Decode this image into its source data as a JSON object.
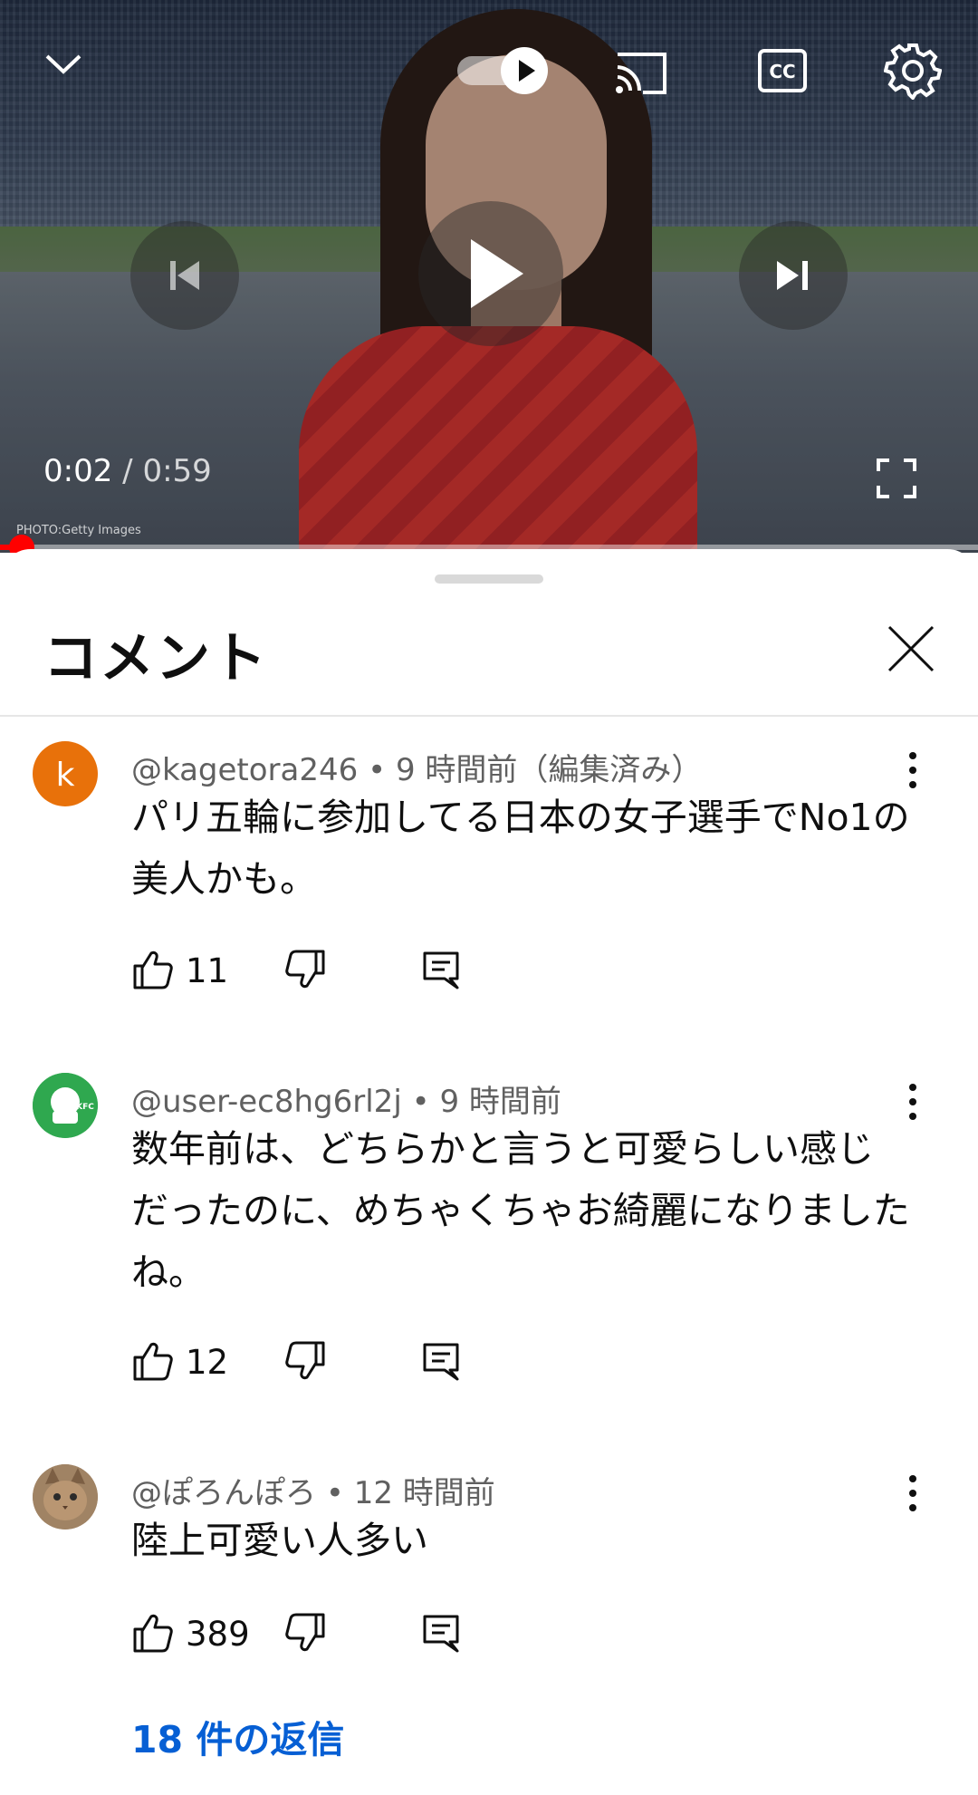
{
  "player": {
    "current_time": "0:02",
    "separator": " / ",
    "duration": "0:59",
    "progress": 0.034,
    "watermark": "PHOTO:Getty Images",
    "autoplay": true,
    "captions": "CC"
  },
  "comments_panel": {
    "title": "コメント",
    "comments": [
      {
        "author": "@kagetora246",
        "time": "9 時間前（編集済み）",
        "avatar_letter": "k",
        "avatar_color": "#e8710a",
        "text": "パリ五輪に参加してる日本の女子選手でNo1の美人かも。",
        "likes": "11"
      },
      {
        "author": "@user-ec8hg6rl2j",
        "time": "9 時間前",
        "avatar_letter": "KFC",
        "avatar_color": "#2fa84f",
        "text": "数年前は、どちらかと言うと可愛らしい感じだったのに、めちゃくちゃお綺麗になりましたね。",
        "likes": "12"
      },
      {
        "author": "@ぽろんぽろ",
        "time": "12 時間前",
        "avatar_letter": "",
        "avatar_color": "#a08364",
        "text": "陸上可愛い人多い",
        "likes": "389"
      }
    ],
    "replies_label": "18 件の返信"
  }
}
